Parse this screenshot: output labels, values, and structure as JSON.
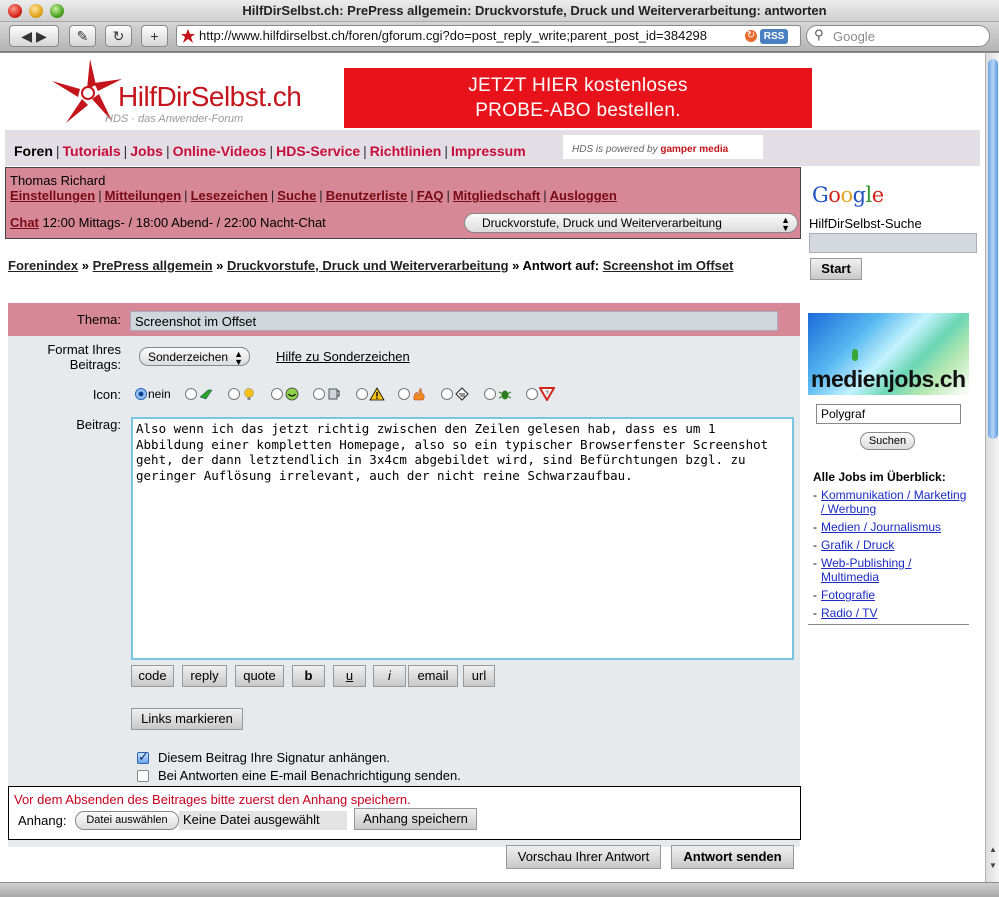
{
  "window": {
    "title": "HilfDirSelbst.ch: PrePress allgemein: Druckvorstufe, Druck und Weiterverarbeitung: antworten",
    "url": "http://www.hilfdirselbst.ch/foren/gforum.cgi?do=post_reply_write;parent_post_id=384298",
    "rss_label": "RSS",
    "search_placeholder": "Google"
  },
  "header": {
    "logo_text_a": "HilfDirSelbst",
    "logo_text_b": ".ch",
    "logo_tagline": "HDS · das Anwender-Forum",
    "banner_line1": "JETZT HIER kostenloses",
    "banner_line2": "PROBE-ABO bestellen."
  },
  "nav": {
    "items": [
      {
        "label": "Foren"
      },
      {
        "label": "Tutorials"
      },
      {
        "label": "Jobs"
      },
      {
        "label": "Online-Videos"
      },
      {
        "label": "HDS-Service"
      },
      {
        "label": "Richtlinien"
      },
      {
        "label": "Impressum"
      }
    ],
    "powered_text": "HDS is powered by",
    "powered_brand": "gamper media"
  },
  "userbox": {
    "username": "Thomas Richard",
    "menu": [
      {
        "label": "Einstellungen"
      },
      {
        "label": "Mitteilungen"
      },
      {
        "label": "Lesezeichen"
      },
      {
        "label": "Suche"
      },
      {
        "label": "Benutzerliste"
      },
      {
        "label": "FAQ"
      },
      {
        "label": "Mitgliedschaft"
      },
      {
        "label": "Ausloggen"
      }
    ],
    "chat_label": "Chat",
    "chat_times": "12:00 Mittags- / 18:00 Abend- / 22:00 Nacht-Chat",
    "forum_selected": "Druckvorstufe, Druck und Weiterverarbeitung"
  },
  "breadcrumb": {
    "items": [
      {
        "label": "Forenindex"
      },
      {
        "label": "PrePress allgemein"
      },
      {
        "label": "Druckvorstufe, Druck und Weiterverarbeitung"
      }
    ],
    "current_prefix": "Antwort auf:",
    "current_link": "Screenshot im Offset",
    "separator": "»"
  },
  "form": {
    "thema_label": "Thema:",
    "thema_value": "Screenshot im Offset",
    "format_label_1": "Format Ihres",
    "format_label_2": "Beitrags:",
    "format_selected": "Sonderzeichen",
    "format_help": "Hilfe zu Sonderzeichen",
    "icon_label": "Icon:",
    "icon_none": "nein",
    "beitrag_label": "Beitrag:",
    "beitrag_text": "Also wenn ich das jetzt richtig zwischen den Zeilen gelesen hab, dass es um 1 Abbildung einer kompletten Homepage, also so ein typischer Browserfenster Screenshot geht, der dann letztendlich in 3x4cm abgebildet wird, sind Befürchtungen bzgl. zu geringer Auflösung irrelevant, auch der nicht reine Schwarzaufbau.",
    "format_buttons": [
      "code",
      "reply",
      "quote",
      "b",
      "u",
      "i",
      "email",
      "url"
    ],
    "links_button": "Links markieren",
    "signature_label": "Diesem Beitrag Ihre Signatur anhängen.",
    "notify_label": "Bei Antworten eine E-mail Benachrichtigung senden.",
    "signature_checked": true,
    "notify_checked": false
  },
  "attachment": {
    "warning": "Vor dem Absenden des Beitrages bitte zuerst den Anhang speichern.",
    "label": "Anhang:",
    "choose_button": "Datei auswählen",
    "no_file": "Keine Datei ausgewählt",
    "save_button": "Anhang speichern"
  },
  "actions": {
    "preview": "Vorschau Ihrer Antwort",
    "send": "Antwort senden"
  },
  "sidebar": {
    "google_search_label": "HilfDirSelbst-Suche",
    "start_button": "Start",
    "medienjobs_word": "medienjobs.ch",
    "jobs_input": "Polygraf",
    "jobs_button": "Suchen",
    "jobs_heading": "Alle Jobs im Überblick:",
    "job_links": [
      "Kommunikation / Marketing / Werbung",
      "Medien / Journalismus",
      "Grafik / Druck",
      "Web-Publishing / Multimedia",
      "Fotografie",
      "Radio / TV"
    ]
  },
  "colors": {
    "brand_red": "#c4151c",
    "nav_red": "#c80c38",
    "userbox_pink": "#d78896",
    "banner_red": "#e8121a",
    "link_blue": "#1b2bc4"
  }
}
